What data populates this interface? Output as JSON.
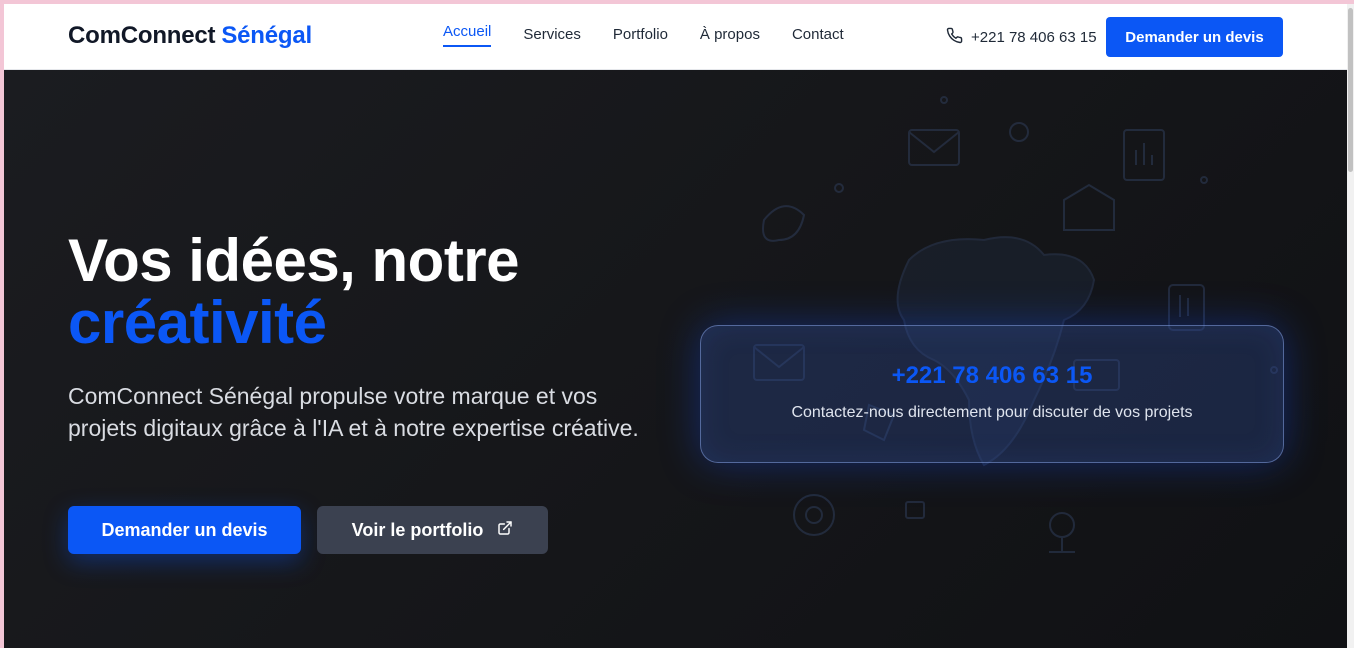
{
  "header": {
    "logo_part1": "ComConnect",
    "logo_part2": "Sénégal",
    "nav": [
      {
        "label": "Accueil",
        "active": true
      },
      {
        "label": "Services",
        "active": false
      },
      {
        "label": "Portfolio",
        "active": false
      },
      {
        "label": "À propos",
        "active": false
      },
      {
        "label": "Contact",
        "active": false
      }
    ],
    "phone": "+221 78 406 63 15",
    "cta_label": "Demander un devis"
  },
  "hero": {
    "title_line1": "Vos idées, notre",
    "title_line2": "créativité",
    "subtitle": "ComConnect Sénégal propulse votre marque et vos projets digitaux grâce à l'IA et à notre expertise créative.",
    "primary_button": "Demander un devis",
    "secondary_button": "Voir le portfolio"
  },
  "contact_card": {
    "phone": "+221 78 406 63 15",
    "text": "Contactez-nous directement pour discuter de vos projets"
  },
  "colors": {
    "accent": "#0b57f5",
    "hero_bg": "#151619",
    "secondary_button": "#3b4150"
  },
  "icons": {
    "phone": "phone-icon",
    "external_link": "external-link-icon"
  }
}
